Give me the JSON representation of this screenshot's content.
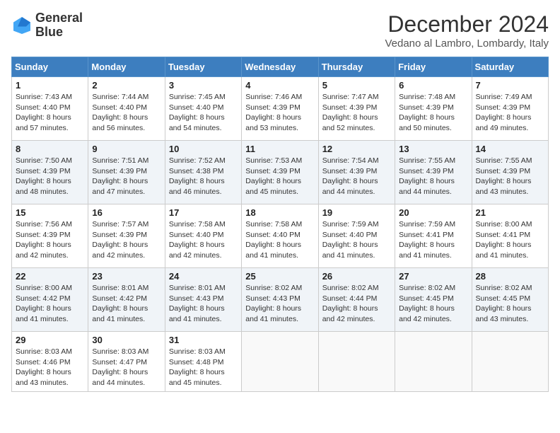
{
  "header": {
    "logo_line1": "General",
    "logo_line2": "Blue",
    "month_title": "December 2024",
    "location": "Vedano al Lambro, Lombardy, Italy"
  },
  "days_of_week": [
    "Sunday",
    "Monday",
    "Tuesday",
    "Wednesday",
    "Thursday",
    "Friday",
    "Saturday"
  ],
  "weeks": [
    [
      {
        "day": 1,
        "sunrise": "7:43 AM",
        "sunset": "4:40 PM",
        "daylight": "8 hours and 57 minutes."
      },
      {
        "day": 2,
        "sunrise": "7:44 AM",
        "sunset": "4:40 PM",
        "daylight": "8 hours and 56 minutes."
      },
      {
        "day": 3,
        "sunrise": "7:45 AM",
        "sunset": "4:40 PM",
        "daylight": "8 hours and 54 minutes."
      },
      {
        "day": 4,
        "sunrise": "7:46 AM",
        "sunset": "4:39 PM",
        "daylight": "8 hours and 53 minutes."
      },
      {
        "day": 5,
        "sunrise": "7:47 AM",
        "sunset": "4:39 PM",
        "daylight": "8 hours and 52 minutes."
      },
      {
        "day": 6,
        "sunrise": "7:48 AM",
        "sunset": "4:39 PM",
        "daylight": "8 hours and 50 minutes."
      },
      {
        "day": 7,
        "sunrise": "7:49 AM",
        "sunset": "4:39 PM",
        "daylight": "8 hours and 49 minutes."
      }
    ],
    [
      {
        "day": 8,
        "sunrise": "7:50 AM",
        "sunset": "4:39 PM",
        "daylight": "8 hours and 48 minutes."
      },
      {
        "day": 9,
        "sunrise": "7:51 AM",
        "sunset": "4:39 PM",
        "daylight": "8 hours and 47 minutes."
      },
      {
        "day": 10,
        "sunrise": "7:52 AM",
        "sunset": "4:38 PM",
        "daylight": "8 hours and 46 minutes."
      },
      {
        "day": 11,
        "sunrise": "7:53 AM",
        "sunset": "4:39 PM",
        "daylight": "8 hours and 45 minutes."
      },
      {
        "day": 12,
        "sunrise": "7:54 AM",
        "sunset": "4:39 PM",
        "daylight": "8 hours and 44 minutes."
      },
      {
        "day": 13,
        "sunrise": "7:55 AM",
        "sunset": "4:39 PM",
        "daylight": "8 hours and 44 minutes."
      },
      {
        "day": 14,
        "sunrise": "7:55 AM",
        "sunset": "4:39 PM",
        "daylight": "8 hours and 43 minutes."
      }
    ],
    [
      {
        "day": 15,
        "sunrise": "7:56 AM",
        "sunset": "4:39 PM",
        "daylight": "8 hours and 42 minutes."
      },
      {
        "day": 16,
        "sunrise": "7:57 AM",
        "sunset": "4:39 PM",
        "daylight": "8 hours and 42 minutes."
      },
      {
        "day": 17,
        "sunrise": "7:58 AM",
        "sunset": "4:40 PM",
        "daylight": "8 hours and 42 minutes."
      },
      {
        "day": 18,
        "sunrise": "7:58 AM",
        "sunset": "4:40 PM",
        "daylight": "8 hours and 41 minutes."
      },
      {
        "day": 19,
        "sunrise": "7:59 AM",
        "sunset": "4:40 PM",
        "daylight": "8 hours and 41 minutes."
      },
      {
        "day": 20,
        "sunrise": "7:59 AM",
        "sunset": "4:41 PM",
        "daylight": "8 hours and 41 minutes."
      },
      {
        "day": 21,
        "sunrise": "8:00 AM",
        "sunset": "4:41 PM",
        "daylight": "8 hours and 41 minutes."
      }
    ],
    [
      {
        "day": 22,
        "sunrise": "8:00 AM",
        "sunset": "4:42 PM",
        "daylight": "8 hours and 41 minutes."
      },
      {
        "day": 23,
        "sunrise": "8:01 AM",
        "sunset": "4:42 PM",
        "daylight": "8 hours and 41 minutes."
      },
      {
        "day": 24,
        "sunrise": "8:01 AM",
        "sunset": "4:43 PM",
        "daylight": "8 hours and 41 minutes."
      },
      {
        "day": 25,
        "sunrise": "8:02 AM",
        "sunset": "4:43 PM",
        "daylight": "8 hours and 41 minutes."
      },
      {
        "day": 26,
        "sunrise": "8:02 AM",
        "sunset": "4:44 PM",
        "daylight": "8 hours and 42 minutes."
      },
      {
        "day": 27,
        "sunrise": "8:02 AM",
        "sunset": "4:45 PM",
        "daylight": "8 hours and 42 minutes."
      },
      {
        "day": 28,
        "sunrise": "8:02 AM",
        "sunset": "4:45 PM",
        "daylight": "8 hours and 43 minutes."
      }
    ],
    [
      {
        "day": 29,
        "sunrise": "8:03 AM",
        "sunset": "4:46 PM",
        "daylight": "8 hours and 43 minutes."
      },
      {
        "day": 30,
        "sunrise": "8:03 AM",
        "sunset": "4:47 PM",
        "daylight": "8 hours and 44 minutes."
      },
      {
        "day": 31,
        "sunrise": "8:03 AM",
        "sunset": "4:48 PM",
        "daylight": "8 hours and 45 minutes."
      },
      null,
      null,
      null,
      null
    ]
  ]
}
